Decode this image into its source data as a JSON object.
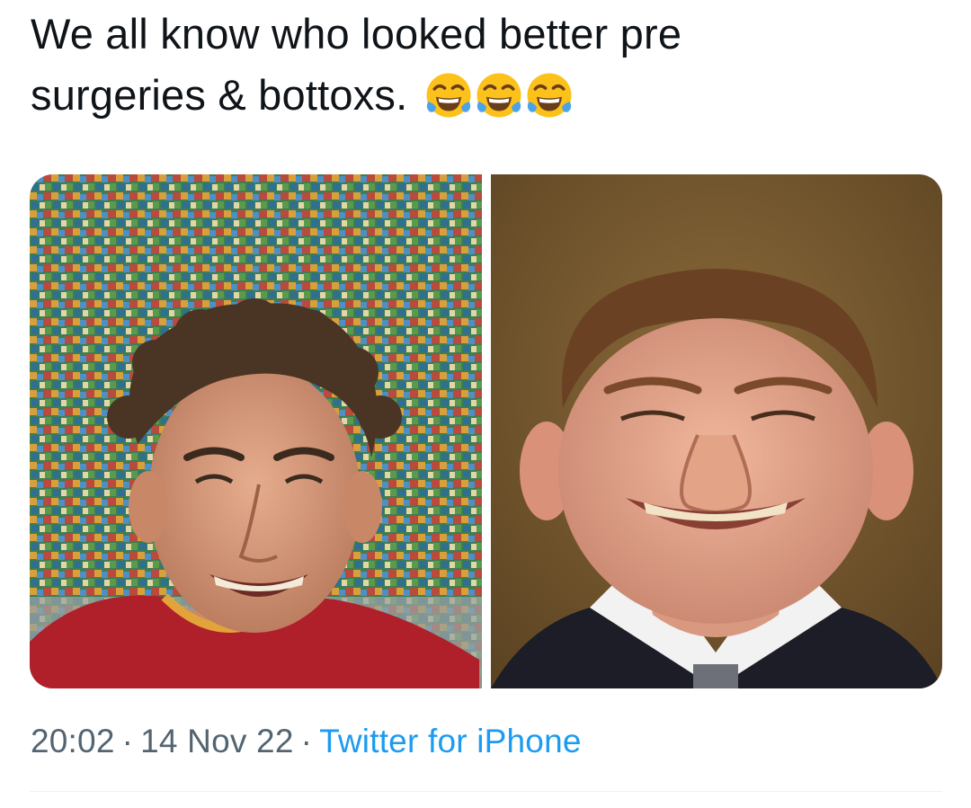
{
  "tweet": {
    "text_line1": "We all know who looked better pre",
    "text_line2": "surgeries & bottoxs.",
    "emojis": [
      "face-with-tears-of-joy-icon",
      "face-with-tears-of-joy-icon",
      "face-with-tears-of-joy-icon"
    ]
  },
  "media": {
    "photos": [
      "photo-young-man-curly-hair-red-jersey",
      "photo-young-man-short-hair-suit"
    ]
  },
  "meta": {
    "time": "20:02",
    "date": "14 Nov 22",
    "source": "Twitter for iPhone",
    "separator": "·"
  },
  "colors": {
    "text": "#0f1419",
    "meta": "#536471",
    "link": "#1d9bf0",
    "divider": "#eff3f4"
  }
}
